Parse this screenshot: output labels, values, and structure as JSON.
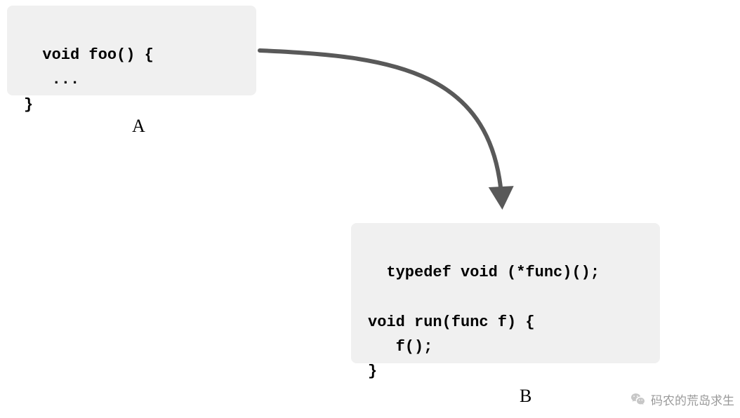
{
  "boxA": {
    "code": "void foo() {\n   ...\n}",
    "label": "A"
  },
  "boxB": {
    "code": "typedef void (*func)();\n\nvoid run(func f) {\n   f();\n}",
    "label": "B"
  },
  "arrow": {
    "color": "#595959",
    "width": 6
  },
  "watermark": {
    "text": "码农的荒岛求生"
  }
}
